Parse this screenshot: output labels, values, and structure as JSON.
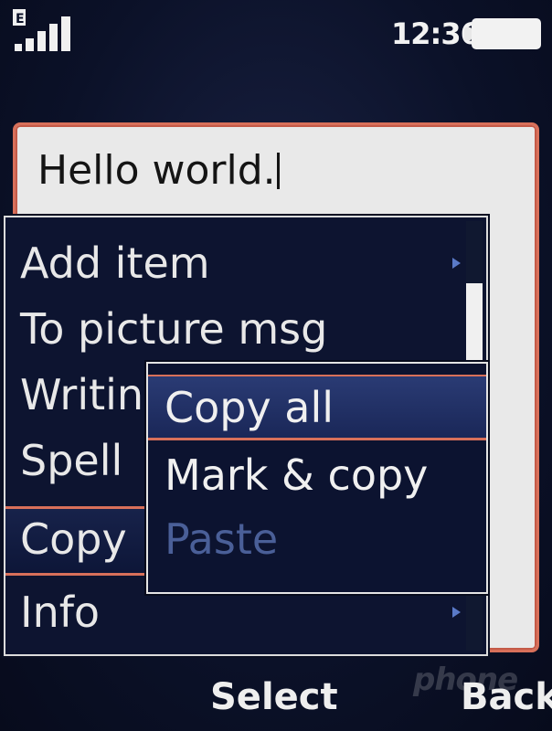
{
  "status_bar": {
    "network_type": "E",
    "time": "12:36",
    "signal_icon": "signal-bars-icon",
    "battery_icon": "battery-icon"
  },
  "editor": {
    "text": "Hello world."
  },
  "options_menu": {
    "items": [
      {
        "label": "Add item",
        "has_submenu": true
      },
      {
        "label": "To picture msg",
        "has_submenu": false
      },
      {
        "label": "Writin",
        "has_submenu": false
      },
      {
        "label": "Spell",
        "has_submenu": false
      },
      {
        "label": "Copy",
        "has_submenu": true
      },
      {
        "label": "Info",
        "has_submenu": true
      }
    ],
    "highlighted": "Copy"
  },
  "submenu": {
    "items": [
      {
        "label": "Copy all",
        "state": "selected"
      },
      {
        "label": "Mark & copy",
        "state": "normal"
      },
      {
        "label": "Paste",
        "state": "disabled"
      }
    ]
  },
  "softkeys": {
    "select": "Select",
    "back": "Back"
  },
  "watermark": "phone",
  "colors": {
    "accent": "#d8705a",
    "menu_bg": "#0d1430",
    "selected_bg": "#2a3b74",
    "disabled_text": "#4a5f98",
    "editor_bg": "#e9e9e9"
  }
}
